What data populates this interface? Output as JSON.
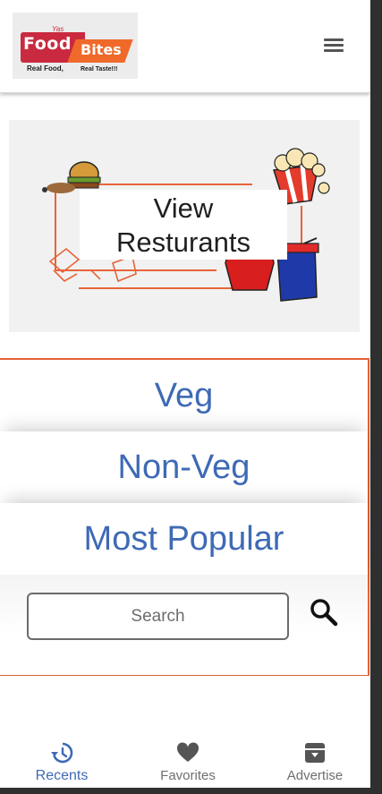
{
  "header": {
    "logo": {
      "word1": "Food",
      "word2": "Bites",
      "tagline1": "Real Food,",
      "tagline2": "Real Taste!!!",
      "script": "Yas",
      "brand_red": "#c92a3f",
      "brand_orange": "#ef6a2a"
    },
    "menu_icon": "hamburger-menu-icon"
  },
  "banner": {
    "label_line1": "View",
    "label_line2": "Resturants"
  },
  "categories": {
    "border_color": "#e26234",
    "text_color": "#3e6ab5",
    "items": [
      {
        "label": "Veg"
      },
      {
        "label": "Non-Veg"
      },
      {
        "label": "Most Popular"
      }
    ]
  },
  "search": {
    "placeholder": "Search",
    "value": "",
    "icon": "search-icon"
  },
  "bottom_nav": {
    "active_color": "#3e6ab5",
    "items": [
      {
        "label": "Recents",
        "icon": "history-icon",
        "active": true
      },
      {
        "label": "Favorites",
        "icon": "heart-icon",
        "active": false
      },
      {
        "label": "Advertise",
        "icon": "archive-icon",
        "active": false
      }
    ]
  }
}
